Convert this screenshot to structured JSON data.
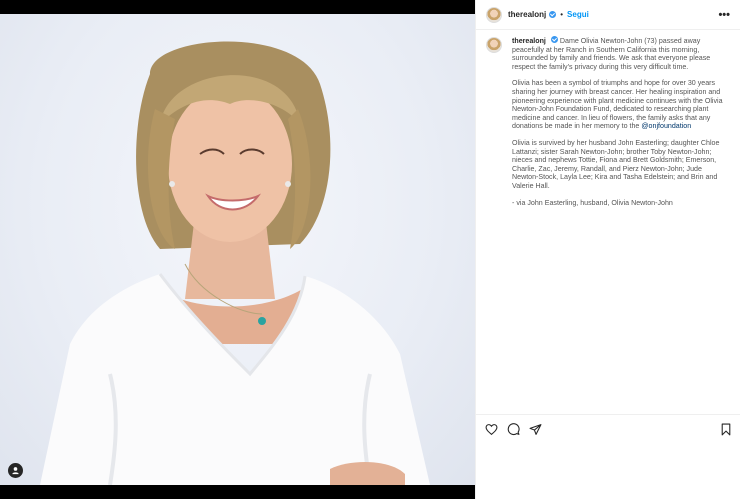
{
  "post": {
    "username": "therealonj",
    "follow_label": "Segui",
    "separator": "•",
    "more_label": "•••",
    "caption": {
      "username": "therealonj",
      "p1": "Dame Olivia Newton-John (73) passed away peacefully at her Ranch in Southern California this morning, surrounded by family and friends. We ask that everyone please respect the family's privacy during this very difficult time.",
      "p2": "Olivia has been a symbol of triumphs and hope for over 30 years sharing her journey with breast cancer. Her healing inspiration and pioneering experience with plant medicine continues with the Olivia Newton-John Foundation Fund, dedicated to researching plant medicine and cancer. In lieu of flowers, the family asks that any donations be made in her memory to the",
      "hashtag": "@onjfoundation",
      "p3": "Olivia is survived by her husband John Easterling; daughter Chloe Lattanzi; sister Sarah Newton-John; brother Toby Newton-John; nieces and nephews Tottie, Fiona and Brett Goldsmith; Emerson, Charlie, Zac, Jeremy, Randall, and Pierz Newton-John; Jude Newton-Stock, Layla Lee; Kira and Tasha Edelstein; and Brin and Valerie Hall.",
      "p4": "- via John Easterling, husband, Olivia Newton-John"
    },
    "icons": {
      "like": "heart-icon",
      "comment": "comment-icon",
      "share": "share-icon",
      "save": "bookmark-icon",
      "tag": "user-tag-icon",
      "verified": "verified-badge-icon"
    },
    "colors": {
      "accent": "#0095f6",
      "verified": "#3897f0",
      "hashtag": "#00376b"
    }
  }
}
